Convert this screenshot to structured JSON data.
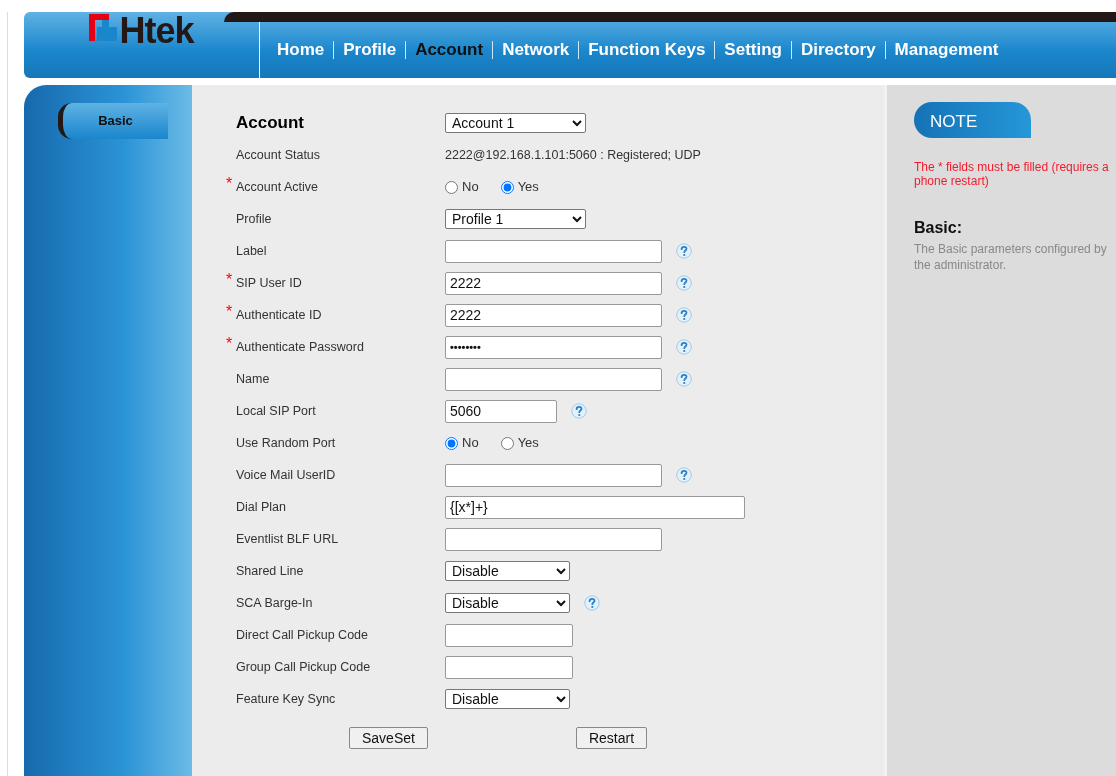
{
  "logo": {
    "text": "Htek"
  },
  "nav": [
    {
      "label": "Home",
      "selected": false
    },
    {
      "label": "Profile",
      "selected": false
    },
    {
      "label": "Account",
      "selected": true
    },
    {
      "label": "Network",
      "selected": false
    },
    {
      "label": "Function Keys",
      "selected": false
    },
    {
      "label": "Setting",
      "selected": false
    },
    {
      "label": "Directory",
      "selected": false
    },
    {
      "label": "Management",
      "selected": false
    }
  ],
  "sidebar": {
    "items": [
      {
        "label": "Basic",
        "selected": true
      }
    ]
  },
  "form": {
    "title": "Account",
    "account_select": "Account 1",
    "fields": [
      {
        "kind": "status",
        "label": "Account Status",
        "value": "2222@192.168.1.101:5060 : Registered; UDP"
      },
      {
        "kind": "radio",
        "label": "Account Active",
        "required_mark": "*",
        "options": [
          {
            "label": "No",
            "selected": false
          },
          {
            "label": "Yes",
            "selected": true
          }
        ]
      },
      {
        "kind": "select",
        "label": "Profile",
        "value": "Profile 1",
        "help": false
      },
      {
        "kind": "text",
        "label": "Label",
        "help": true
      },
      {
        "kind": "text",
        "label": "SIP User ID",
        "required_mark": "*",
        "value": "2222",
        "help": true
      },
      {
        "kind": "text",
        "label": "Authenticate ID",
        "required_mark": "*",
        "value": "2222",
        "help": true
      },
      {
        "kind": "password",
        "label": "Authenticate Password",
        "required_mark": "*",
        "value": "••••••••",
        "help": true
      },
      {
        "kind": "text",
        "label": "Name",
        "help": true
      },
      {
        "kind": "text",
        "label": "Local SIP Port",
        "value": "5060",
        "help": true
      },
      {
        "kind": "radio",
        "label": "Use Random Port",
        "options": [
          {
            "label": "No",
            "selected": true
          },
          {
            "label": "Yes",
            "selected": false
          }
        ]
      },
      {
        "kind": "text",
        "label": "Voice Mail UserID",
        "help": true
      },
      {
        "kind": "text",
        "label": "Dial Plan",
        "value": "{[x*]+}",
        "help": false
      },
      {
        "kind": "text",
        "label": "Eventlist BLF URL",
        "help": false
      },
      {
        "kind": "select",
        "label": "Shared Line",
        "value": "Disable",
        "help": false
      },
      {
        "kind": "select",
        "label": "SCA Barge-In",
        "value": "Disable",
        "help": true
      },
      {
        "kind": "text",
        "label": "Direct Call Pickup Code",
        "help": false
      },
      {
        "kind": "text",
        "label": "Group Call Pickup Code",
        "help": false
      },
      {
        "kind": "select",
        "label": "Feature Key Sync",
        "value": "Disable",
        "help": false
      }
    ],
    "buttons": [
      "SaveSet",
      "Restart"
    ]
  },
  "note": {
    "title": "NOTE",
    "warning_lines": [
      "The * fields must be filled (requires a",
      "phone restart)"
    ],
    "section_title": "Basic:",
    "description_lines": [
      "The Basic parameters configured by",
      "the administrator."
    ]
  }
}
